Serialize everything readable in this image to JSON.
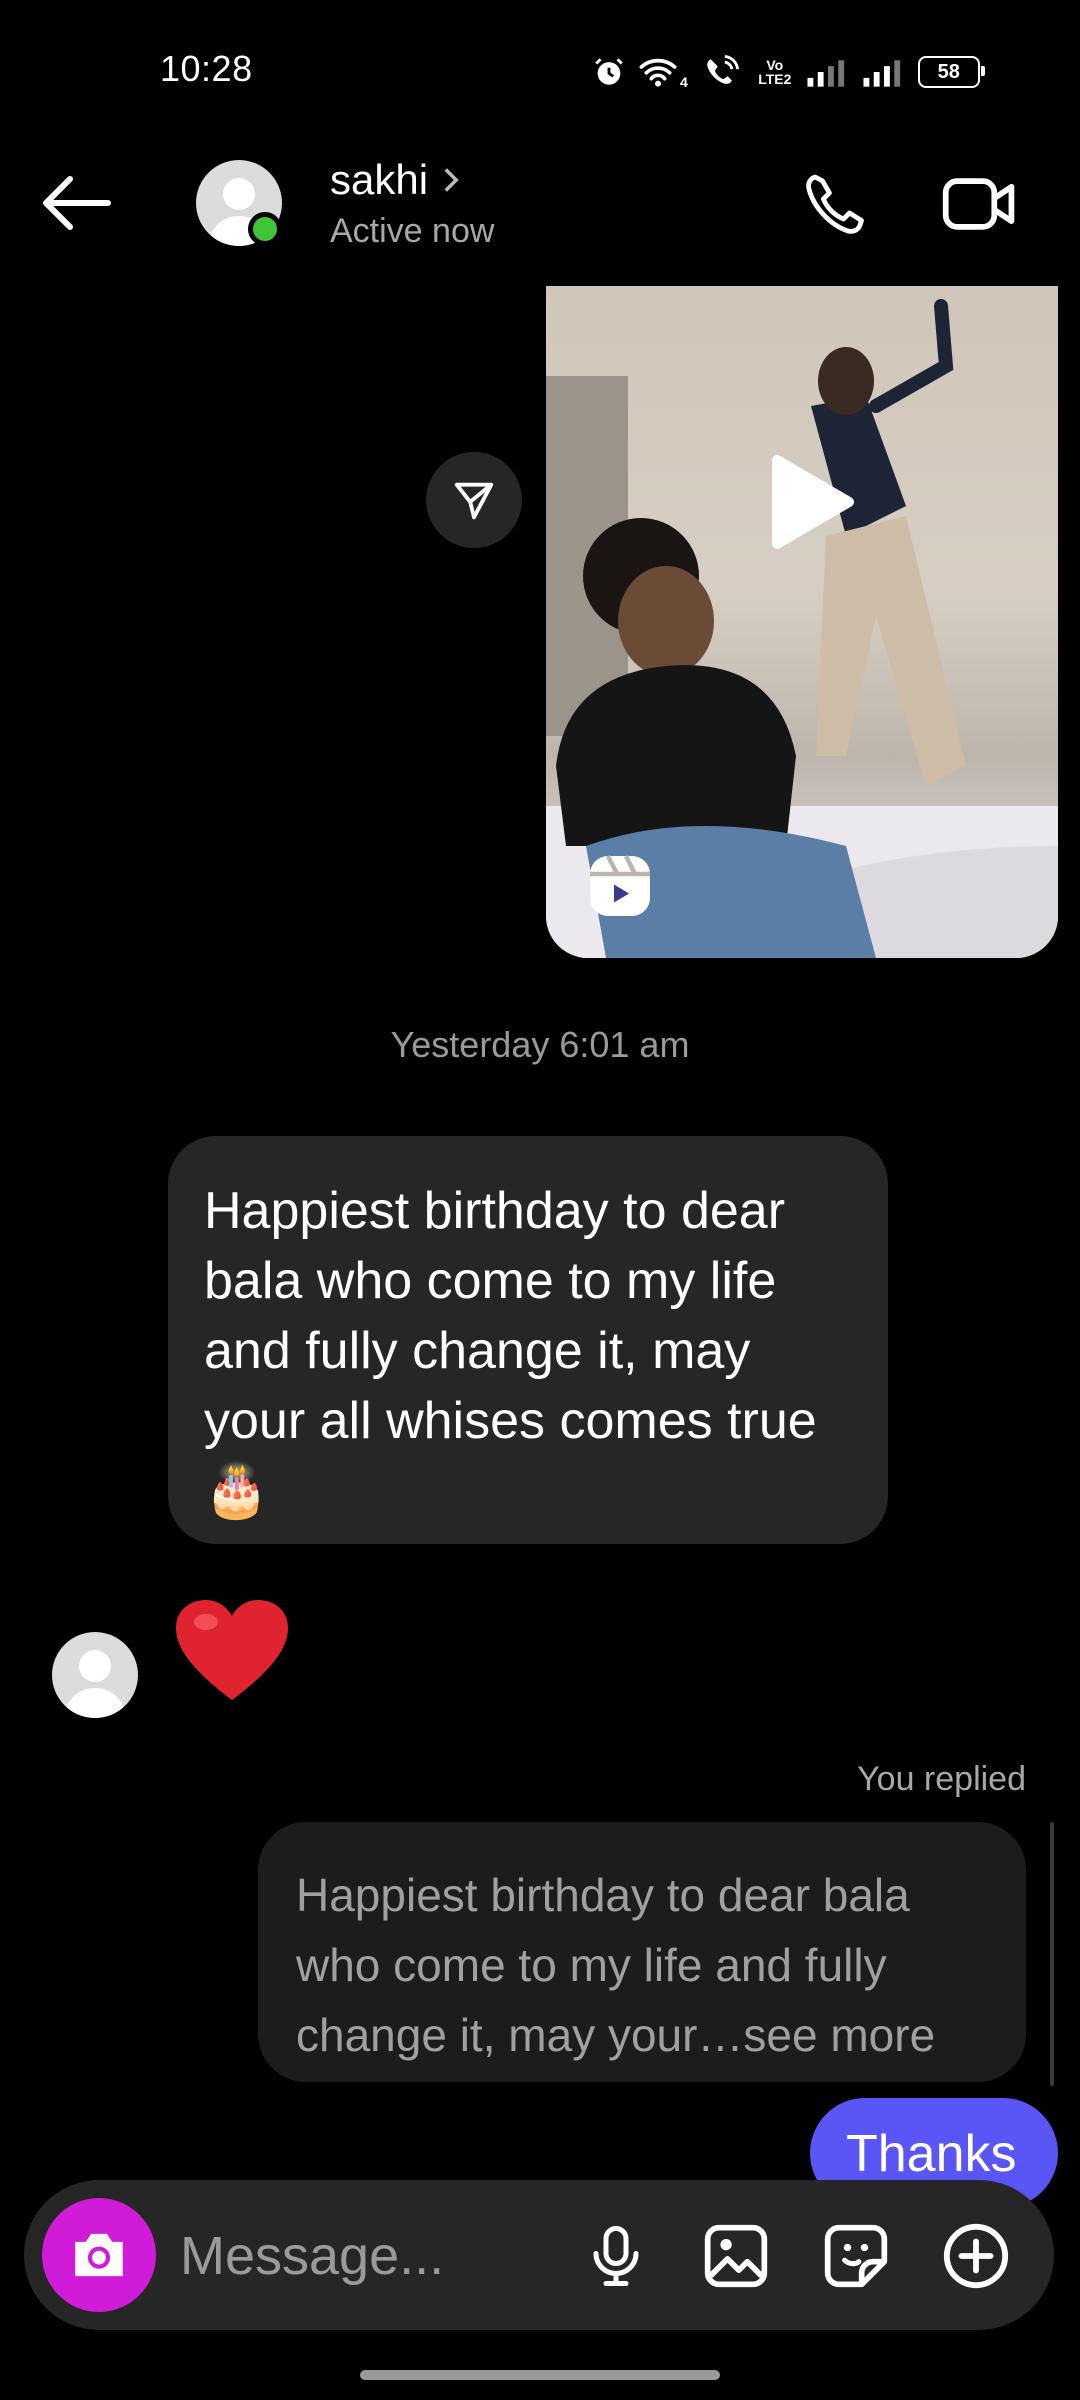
{
  "status_bar": {
    "time": "10:28",
    "network_label": "4",
    "volte_label": "Vo LTE2",
    "battery": "58"
  },
  "header": {
    "contact_name": "sakhi",
    "contact_status": "Active now"
  },
  "messages": {
    "timestamp": "Yesterday 6:01 am",
    "received_text": "Happiest birthday to dear bala who come to my life and fully change it, may your all whises comes true 🎂",
    "reaction_icon": "heart-icon",
    "replied_label": "You replied",
    "reply_quote": "Happiest birthday to dear bala who come to my life and fully change it, may your…see more",
    "sent_text": "Thanks"
  },
  "composer": {
    "placeholder": "Message..."
  },
  "colors": {
    "background": "#000000",
    "bubble_received": "#262626",
    "bubble_sent": "#5a55f5",
    "camera_button": "#d01cd8",
    "online_dot": "#3fc43a"
  }
}
